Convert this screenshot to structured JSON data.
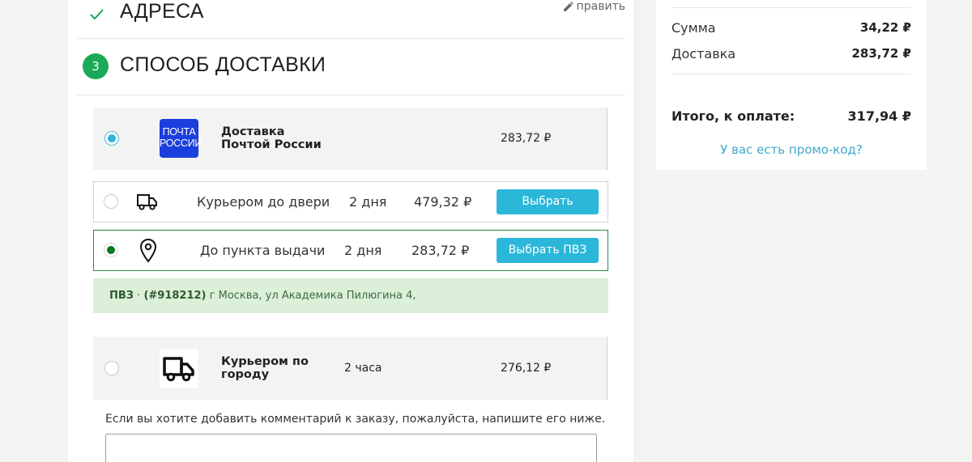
{
  "addresses": {
    "title": "АДРЕСА",
    "edit_label": "править"
  },
  "delivery": {
    "step": "3",
    "title": "СПОСОБ ДОСТАВКИ"
  },
  "options": {
    "pochta": {
      "logo_line1": "ПОЧТА",
      "logo_line2": "РОССИИ",
      "name_line1": "Доставка",
      "name_line2": "Почтой России",
      "price": "283,72 ₽",
      "selected": true
    },
    "courier": {
      "name": "Курьером до двери",
      "time": "2 дня",
      "price": "479,32 ₽",
      "button": "Выбрать"
    },
    "pvz": {
      "name": "До пункта выдачи",
      "time": "2 дня",
      "price": "283,72 ₽",
      "button": "Выбрать ПВЗ",
      "selected": true
    },
    "pvz_info": {
      "label": "ПВЗ",
      "separator": "·",
      "code": "(#918212)",
      "address": "г Москва, ул Академика Пилюгина 4,"
    },
    "city": {
      "name_line1": "Курьером по",
      "name_line2": "городу",
      "time": "2 часа",
      "price": "276,12 ₽"
    }
  },
  "comment": {
    "label": "Если вы хотите добавить комментарий к заказу, пожалуйста, напишите его ниже.",
    "value": ""
  },
  "summary": {
    "sum_label": "Сумма",
    "sum_value": "34,22 ₽",
    "delivery_label": "Доставка",
    "delivery_value": "283,72 ₽",
    "total_label": "Итого, к оплате:",
    "total_value": "317,94 ₽",
    "promo": "У вас есть промо-код?"
  },
  "colors": {
    "accent_green": "#1aaa55",
    "button_blue": "#2bb7d9",
    "pochta_blue": "#1a3fdc",
    "pvz_bg": "#dcefd9",
    "link": "#3ea8cc"
  }
}
